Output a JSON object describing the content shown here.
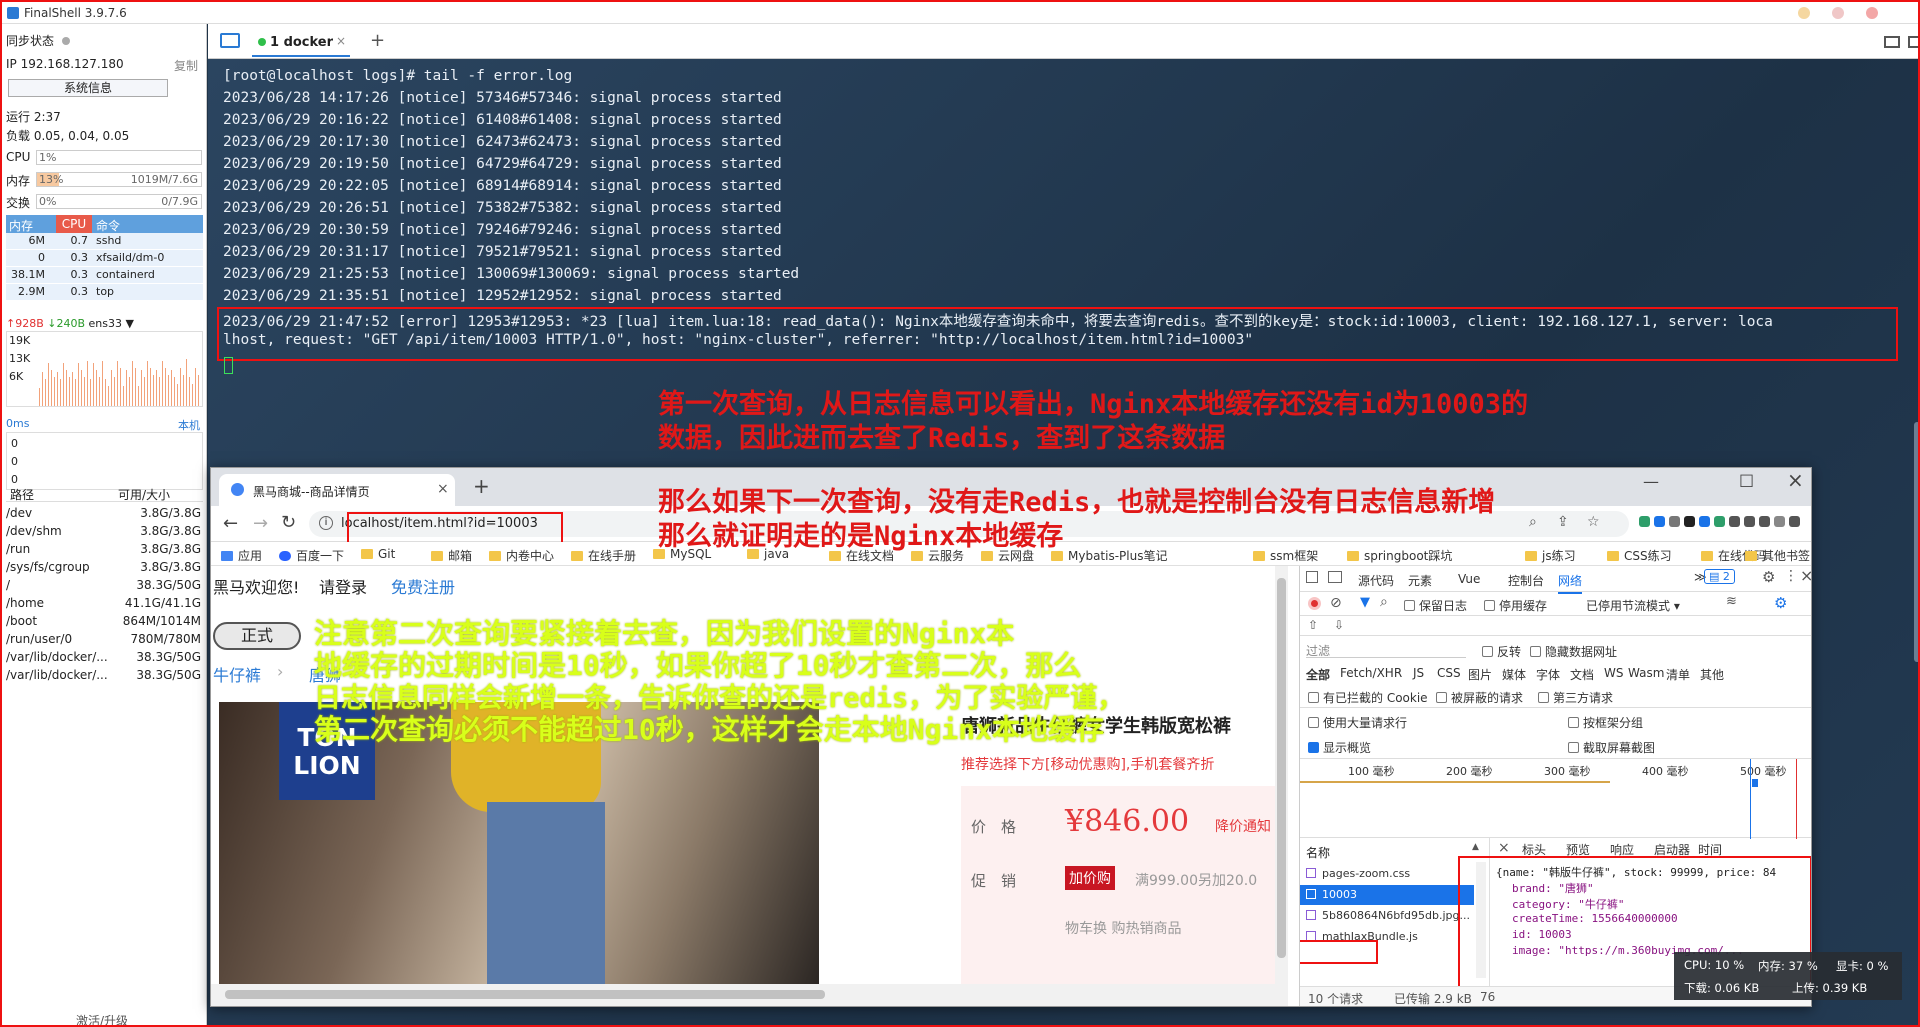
{
  "app": {
    "title": "FinalShell 3.9.7.6"
  },
  "sidebar": {
    "sync_label": "同步状态",
    "ip": "IP 192.168.127.180",
    "copy": "复制",
    "sysinfo_btn": "系统信息",
    "uptime": "运行 2:37",
    "load": "负载 0.05, 0.04, 0.05",
    "cpu_label": "CPU",
    "cpu_value": "1%",
    "mem_label": "内存",
    "mem_pct": "13%",
    "mem_value": "1019M/7.6G",
    "swap_label": "交换",
    "swap_pct": "0%",
    "swap_value": "0/7.9G",
    "proc_headers": [
      "内存",
      "CPU",
      "命令"
    ],
    "procs": [
      [
        "6M",
        "0.7",
        "sshd"
      ],
      [
        "0",
        "0.3",
        "xfsaild/dm-0"
      ],
      [
        "38.1M",
        "0.3",
        "containerd"
      ],
      [
        "2.9M",
        "0.3",
        "top"
      ]
    ],
    "net_up": "↑928B",
    "net_down": "↓240B",
    "net_if": "ens33",
    "net_scale": [
      "19K",
      "13K",
      "6K"
    ],
    "ping": "0ms",
    "ping_host": "本机",
    "ping_vals": [
      "0",
      "0",
      "0"
    ],
    "disk_headers": [
      "路径",
      "可用/大小"
    ],
    "disks": [
      [
        "/dev",
        "3.8G/3.8G"
      ],
      [
        "/dev/shm",
        "3.8G/3.8G"
      ],
      [
        "/run",
        "3.8G/3.8G"
      ],
      [
        "/sys/fs/cgroup",
        "3.8G/3.8G"
      ],
      [
        "/",
        "38.3G/50G"
      ],
      [
        "/home",
        "41.1G/41.1G"
      ],
      [
        "/boot",
        "864M/1014M"
      ],
      [
        "/run/user/0",
        "780M/780M"
      ],
      [
        "/var/lib/docker/...",
        "38.3G/50G"
      ],
      [
        "/var/lib/docker/...",
        "38.3G/50G"
      ]
    ],
    "upgrade": "激活/升级"
  },
  "terminal": {
    "tab": "1 docker",
    "lines": [
      "[root@localhost logs]# tail -f error.log",
      "2023/06/28 14:17:26 [notice] 57346#57346: signal process started",
      "2023/06/29 20:16:22 [notice] 61408#61408: signal process started",
      "2023/06/29 20:17:30 [notice] 62473#62473: signal process started",
      "2023/06/29 20:19:50 [notice] 64729#64729: signal process started",
      "2023/06/29 20:22:05 [notice] 68914#68914: signal process started",
      "2023/06/29 20:26:51 [notice] 75382#75382: signal process started",
      "2023/06/29 20:30:59 [notice] 79246#79246: signal process started",
      "2023/06/29 20:31:17 [notice] 79521#79521: signal process started",
      "2023/06/29 21:25:53 [notice] 130069#130069: signal process started",
      "2023/06/29 21:35:51 [notice] 12952#12952: signal process started",
      "2023/06/29 21:47:52 [error] 12953#12953: *23 [lua] item.lua:18: read_data(): Nginx本地缓存查询未命中，将要去查询redis。查不到的key是：stock:id:10003, client: 192.168.127.1, server: loca",
      "lhost, request: \"GET /api/item/10003 HTTP/1.0\", host: \"nginx-cluster\", referrer: \"http://localhost/item.html?id=10003\""
    ]
  },
  "annotations": {
    "red": [
      "第一次查询，从日志信息可以看出，Nginx本地缓存还没有id为10003的",
      "数据，因此进而去查了Redis，查到了这条数据",
      "那么如果下一次查询，没有走Redis，也就是控制台没有日志信息新增",
      "那么就证明走的是Nginx本地缓存"
    ],
    "yellow": [
      "注意第二次查询要紧接着去查，因为我们设置的Nginx本",
      "地缓存的过期时间是10秒，如果你超了10秒才查第二次，那么",
      "日志信息同样会新增一条，告诉你查的还是redis，为了实验严谨，",
      "第二次查询必须不能超过10秒，这样才会走本地Nginx本地缓存"
    ]
  },
  "browser": {
    "tab_title": "黑马商城--商品详情页",
    "url": "localhost/item.html?id=10003",
    "bookmarks": [
      "应用",
      "百度一下",
      "Git",
      "邮箱",
      "内卷中心",
      "在线手册",
      "MySQL",
      "java",
      "在线文档",
      "云服务",
      "云网盘",
      "Mybatis-Plus笔记",
      "ssm框架",
      "springboot踩坑",
      "js练习",
      "CSS练习",
      "在线代码",
      "其他书签"
    ],
    "page": {
      "welcome": "黑马欢迎您!",
      "login": "请登录",
      "register": "免费注册",
      "badge": "正式",
      "crumbs": [
        "牛仔裤",
        "唐狮"
      ],
      "logo": [
        "TON",
        "LION"
      ],
      "product_title": "唐狮新品牛仔裤女学生韩版宽松裤",
      "promo": "推荐选择下方[移动优惠购],手机套餐齐折",
      "price_label": "价　格",
      "price": "¥846.00",
      "price_notice": "降价通知",
      "promo_label": "促　销",
      "promo_btn": "加价购",
      "promo_text": "满999.00另加20.0",
      "more": "物车换  购热销商品"
    },
    "devtools": {
      "tabs": [
        "源代码",
        "元素",
        "Vue",
        "控制台",
        "网络"
      ],
      "badge": "2",
      "preserve": "保留日志",
      "disable_cache": "停用缓存",
      "throttle": "已停用节流模式",
      "filter": "过滤",
      "invert": "反转",
      "hide_data": "隐藏数据网址",
      "types": [
        "全部",
        "Fetch/XHR",
        "JS",
        "CSS",
        "图片",
        "媒体",
        "字体",
        "文档",
        "WS",
        "Wasm",
        "清单",
        "其他"
      ],
      "blocked_cookie": "有已拦截的 Cookie",
      "blocked_req": "被屏蔽的请求",
      "third_party": "第三方请求",
      "big_rows": "使用大量请求行",
      "group": "按框架分组",
      "overview": "显示概览",
      "screenshot": "截取屏幕截图",
      "timeline": [
        "100 毫秒",
        "200 毫秒",
        "300 毫秒",
        "400 毫秒",
        "500 毫秒"
      ],
      "name_col": "名称",
      "requests": [
        "pages-zoom.css",
        "10003",
        "5b860864N6bfd95db.jpg...",
        "mathJaxBundle.js"
      ],
      "detail_tabs": [
        "标头",
        "预览",
        "响应",
        "启动器",
        "时间"
      ],
      "status": "10 个请求",
      "transfer": "已传输 2.9 kB",
      "status_more": "76",
      "json": [
        "{name: \"韩版牛仔裤\", stock: 99999, price: 84",
        "brand: \"唐狮\"",
        "category: \"牛仔裤\"",
        "createTime: 1556640000000",
        "id: 10003",
        "image: \"https://m.360buyimg.com/..."
      ]
    }
  },
  "sysmon": {
    "cpu": "CPU: 10 %",
    "mem": "内存: 37 %",
    "gpu": "显卡: 0 %",
    "down": "下载: 0.06 KB",
    "up": "上传: 0.39 KB"
  }
}
